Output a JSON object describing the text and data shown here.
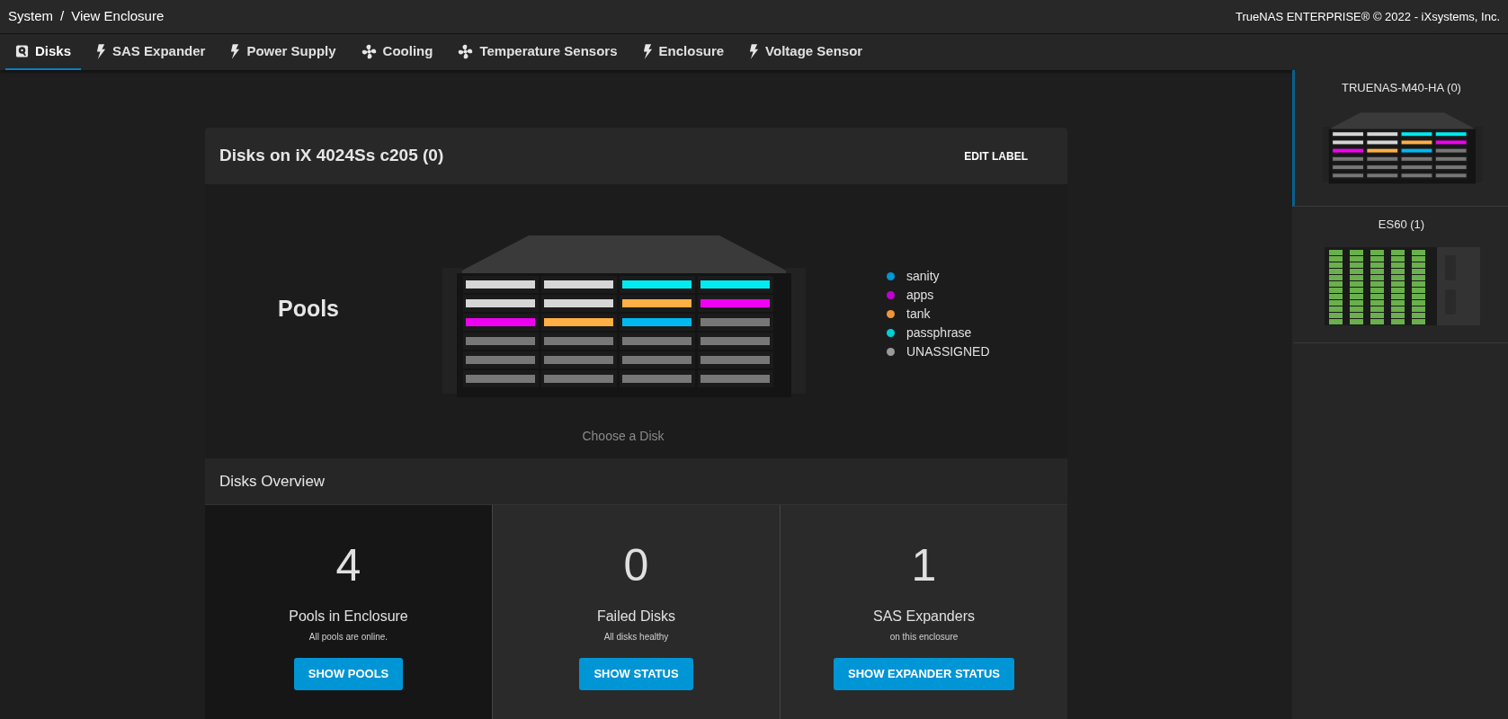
{
  "breadcrumb": {
    "parent": "System",
    "separator": "/",
    "current": "View Enclosure"
  },
  "copyright": "TrueNAS ENTERPRISE® © 2022 - iXsystems, Inc.",
  "tabs": [
    {
      "label": "Disks",
      "kind": "disk",
      "selected": true
    },
    {
      "label": "SAS Expander",
      "kind": "bolt",
      "selected": false
    },
    {
      "label": "Power Supply",
      "kind": "bolt",
      "selected": false
    },
    {
      "label": "Cooling",
      "kind": "fan",
      "selected": false
    },
    {
      "label": "Temperature Sensors",
      "kind": "fan",
      "selected": false
    },
    {
      "label": "Enclosure",
      "kind": "bolt",
      "selected": false
    },
    {
      "label": "Voltage Sensor",
      "kind": "bolt",
      "selected": false
    }
  ],
  "card": {
    "title": "Disks on iX 4024Ss c205 (0)",
    "edit_button": "EDIT LABEL",
    "heading": "Pools",
    "hint": "Choose a Disk",
    "slots": [
      {
        "color": "#d6d6d6"
      },
      {
        "color": "#d6d6d6"
      },
      {
        "color": "#00eaf2"
      },
      {
        "color": "#00eaf2"
      },
      {
        "color": "#d6d6d6"
      },
      {
        "color": "#d6d6d6"
      },
      {
        "color": "#ffaf45"
      },
      {
        "color": "#f000f0"
      },
      {
        "color": "#f000f0"
      },
      {
        "color": "#ffaf45"
      },
      {
        "color": "#00b8f0"
      },
      {
        "color": "#777777"
      },
      {
        "color": "#777777"
      },
      {
        "color": "#777777"
      },
      {
        "color": "#777777"
      },
      {
        "color": "#777777"
      },
      {
        "color": "#777777"
      },
      {
        "color": "#777777"
      },
      {
        "color": "#777777"
      },
      {
        "color": "#777777"
      },
      {
        "color": "#777777"
      },
      {
        "color": "#777777"
      },
      {
        "color": "#777777"
      },
      {
        "color": "#777777"
      }
    ],
    "legend": [
      {
        "label": "sanity",
        "color": "#0095d5"
      },
      {
        "label": "apps",
        "color": "#c000d0"
      },
      {
        "label": "tank",
        "color": "#f0963a"
      },
      {
        "label": "passphrase",
        "color": "#00cfd5"
      },
      {
        "label": "UNASSIGNED",
        "color": "#9a9a9a"
      }
    ]
  },
  "overview": {
    "title": "Disks Overview",
    "stats": [
      {
        "value": "4",
        "title": "Pools in Enclosure",
        "subtitle": "All pools are online.",
        "button": "SHOW POOLS",
        "highlighted": true
      },
      {
        "value": "0",
        "title": "Failed Disks",
        "subtitle": "All disks healthy",
        "button": "SHOW STATUS",
        "highlighted": false
      },
      {
        "value": "1",
        "title": "SAS Expanders",
        "subtitle": "on this enclosure",
        "button": "SHOW EXPANDER STATUS",
        "highlighted": false
      }
    ]
  },
  "sidebar": {
    "items": [
      {
        "label": "TRUENAS-M40-HA (0)",
        "kind": "rack",
        "selected": true,
        "slots": [
          {
            "color": "#d6d6d6"
          },
          {
            "color": "#d6d6d6"
          },
          {
            "color": "#00eaf2"
          },
          {
            "color": "#00eaf2"
          },
          {
            "color": "#d6d6d6"
          },
          {
            "color": "#d6d6d6"
          },
          {
            "color": "#ffaf45"
          },
          {
            "color": "#f000f0"
          },
          {
            "color": "#f000f0"
          },
          {
            "color": "#ffaf45"
          },
          {
            "color": "#00b8f0"
          },
          {
            "color": "#777777"
          },
          {
            "color": "#777777"
          },
          {
            "color": "#777777"
          },
          {
            "color": "#777777"
          },
          {
            "color": "#777777"
          },
          {
            "color": "#777777"
          },
          {
            "color": "#777777"
          },
          {
            "color": "#777777"
          },
          {
            "color": "#777777"
          },
          {
            "color": "#777777"
          },
          {
            "color": "#777777"
          },
          {
            "color": "#777777"
          },
          {
            "color": "#777777"
          }
        ]
      },
      {
        "label": "ES60 (1)",
        "kind": "shelf",
        "selected": false
      }
    ]
  }
}
